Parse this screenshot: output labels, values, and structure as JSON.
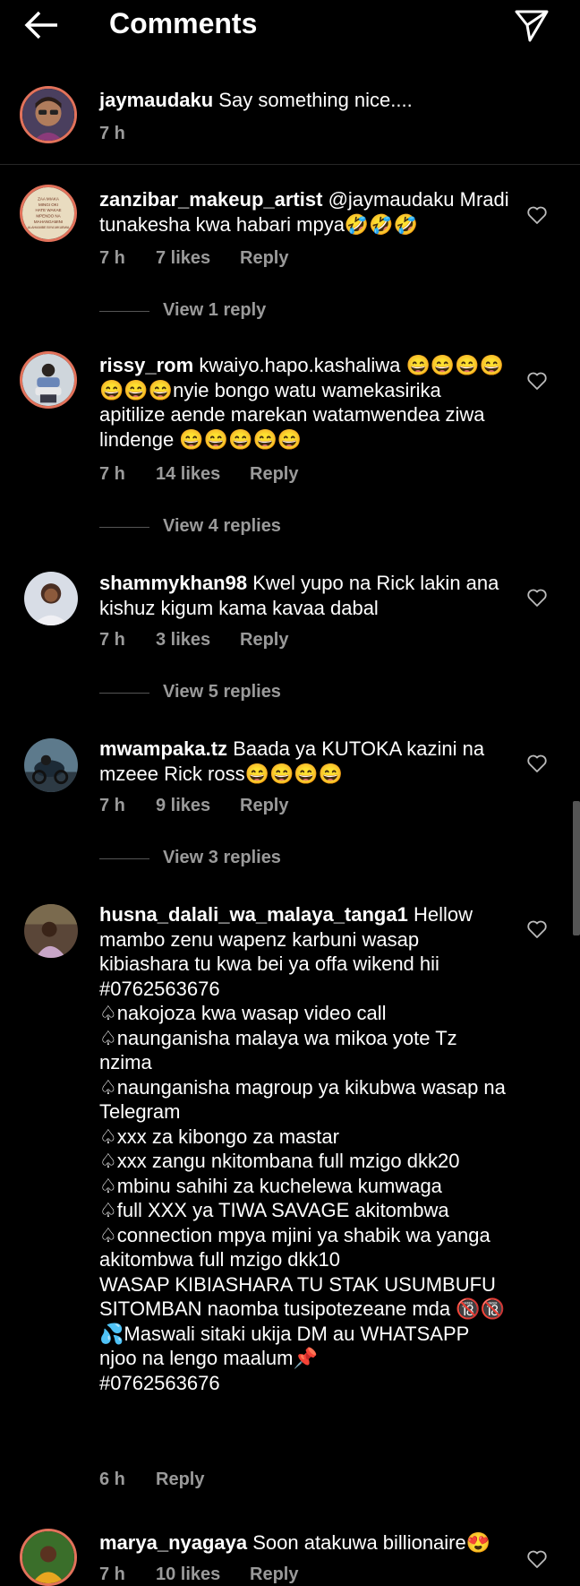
{
  "header": {
    "title": "Comments"
  },
  "caption": {
    "username": "jaymaudaku",
    "text": "Say something nice....",
    "time": "7 h"
  },
  "comments": [
    {
      "username": "zanzibar_makeup_artist",
      "text": "@jaymaudaku Mradi tunakesha kwa habari mpya🤣🤣🤣",
      "time": "7 h",
      "likes": "7 likes",
      "reply": "Reply",
      "view_replies": "View 1 reply"
    },
    {
      "username": "rissy_rom",
      "text": "kwaiyo.hapo.kashaliwa 😄😄😄😄😄😄😄nyie bongo watu wamekasirika apitilize aende marekan watamwendea ziwa lindenge 😄😄😄😄😄",
      "time": "7 h",
      "likes": "14 likes",
      "reply": "Reply",
      "view_replies": "View 4 replies"
    },
    {
      "username": "shammykhan98",
      "text": "Kwel yupo na Rick lakin ana kishuz kigum kama kavaa dabal",
      "time": "7 h",
      "likes": "3 likes",
      "reply": "Reply",
      "view_replies": "View 5 replies"
    },
    {
      "username": "mwampaka.tz",
      "text": "Baada ya KUTOKA kazini na mzeee Rick ross😄😄😄😄",
      "time": "7 h",
      "likes": "9 likes",
      "reply": "Reply",
      "view_replies": "View 3 replies"
    },
    {
      "username": "husna_dalali_wa_malaya_tanga1",
      "text": "Hellow mambo zenu wapenz karbuni wasap kibiashara tu kwa bei ya offa wikend hii #0762563676\n♤nakojoza kwa wasap video call\n♤naunganisha malaya wa mikoa yote Tz nzima\n♤naunganisha magroup ya kikubwa wasap na Telegram\n♤xxx za kibongo za mastar\n♤xxx zangu nkitombana full mzigo dkk20\n♤mbinu sahihi za kuchelewa kumwaga\n♤full XXX ya TIWA SAVAGE akitombwa\n♤connection mpya mjini ya shabik wa yanga akitombwa full mzigo dkk10\nWASAP KIBIASHARA TU STAK USUMBUFU SITOMBAN naomba tusipotezeane mda 🔞🔞\n💦Maswali sitaki ukija DM au WHATSAPP njoo na lengo maalum📌\n#0762563676",
      "time": "6 h",
      "reply": "Reply"
    },
    {
      "username": "marya_nyagaya",
      "text": "Soon atakuwa billionaire😍",
      "time": "7 h",
      "likes": "10 likes",
      "reply": "Reply"
    }
  ],
  "zanzibar_avatar_text": [
    "ZAA MIAKA",
    "MINGI OKI",
    "HATE WAKAE",
    "MPENDO NA",
    "MAHANGAMINI",
    "ALAHIAMBE BIYA MKUBWA"
  ]
}
